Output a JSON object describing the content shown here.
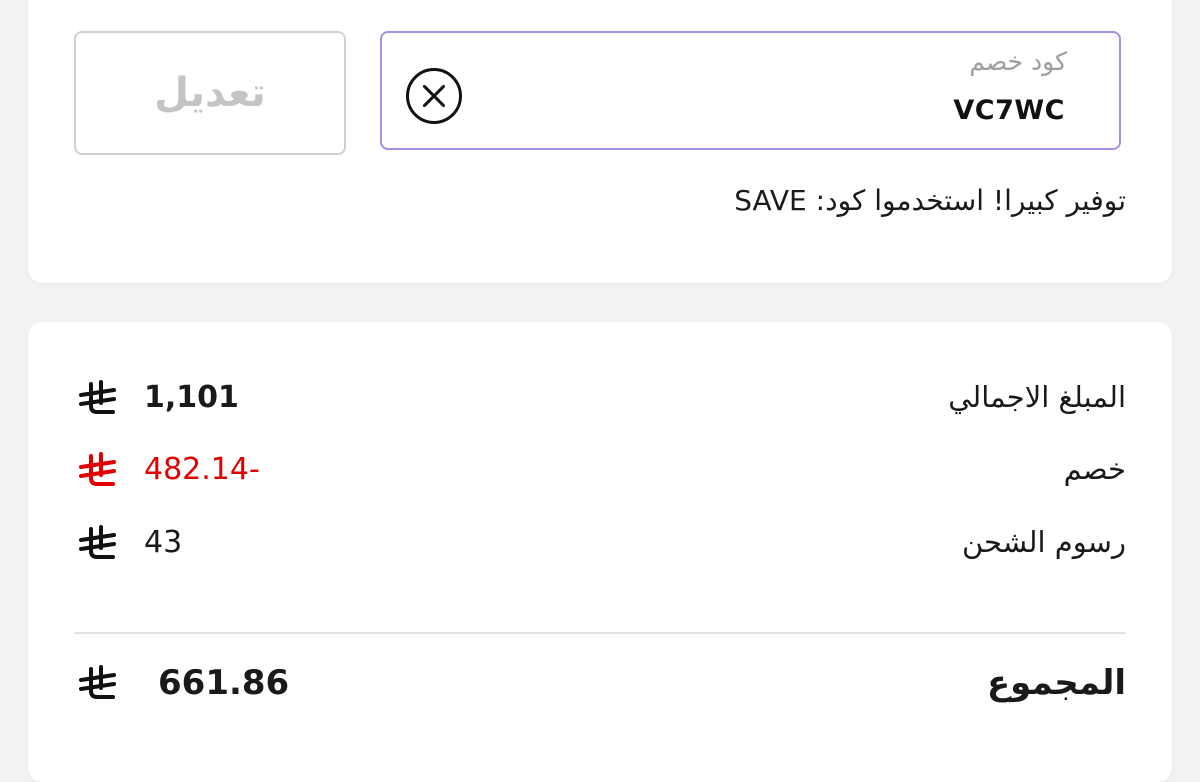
{
  "coupon": {
    "label": "كود خصم",
    "value": "VC7WC",
    "edit_label": "تعديل",
    "promo_text": "توفير كبيرا! استخدموا كود: SAVE"
  },
  "summary": {
    "rows": [
      {
        "label": "المبلغ الاجمالي",
        "amount": "1,101"
      },
      {
        "label": "خصم",
        "amount": "-482.14"
      },
      {
        "label": "رسوم الشحن",
        "amount": "43"
      }
    ],
    "total": {
      "label": "المجموع",
      "amount": "661.86"
    }
  },
  "colors": {
    "accent_border": "#a98ee6",
    "discount_red": "#e00000"
  },
  "icons": {
    "clear": "close-circle-icon",
    "currency": "riyal-icon"
  }
}
